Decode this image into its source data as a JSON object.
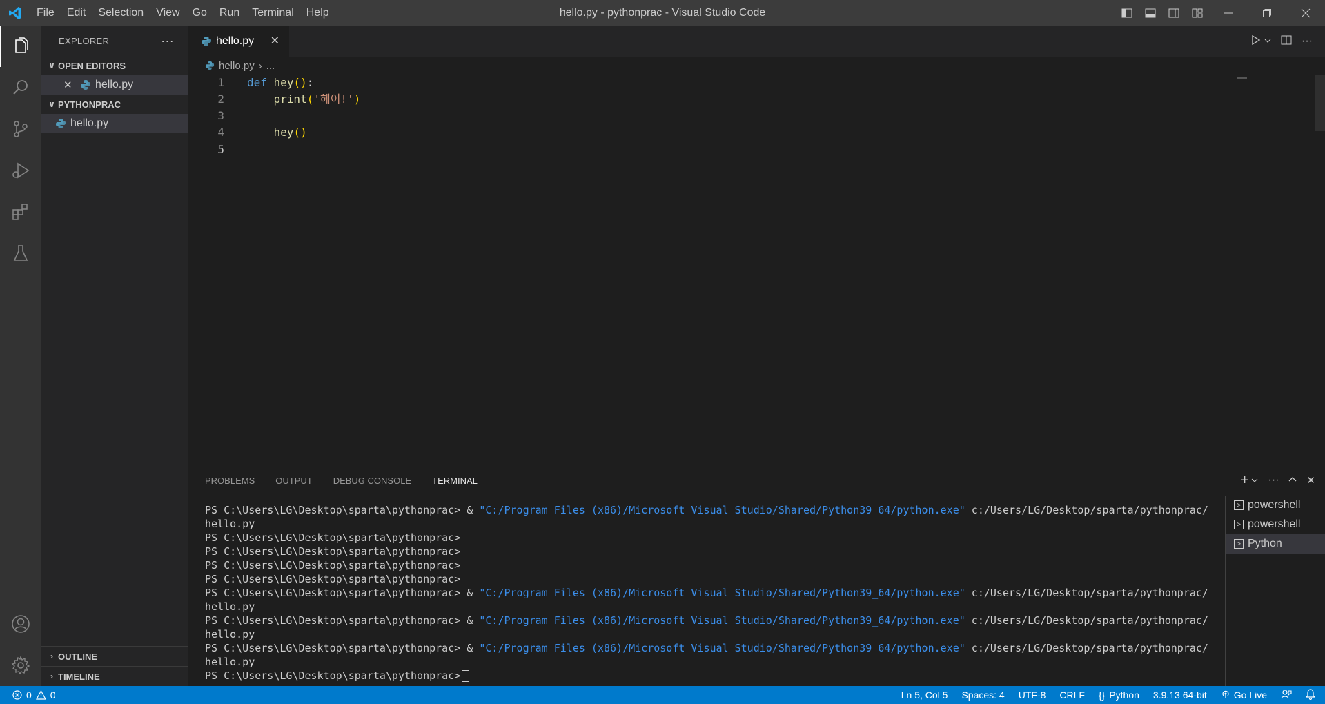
{
  "window": {
    "title": "hello.py - pythonprac - Visual Studio Code",
    "menu": [
      "File",
      "Edit",
      "Selection",
      "View",
      "Go",
      "Run",
      "Terminal",
      "Help"
    ]
  },
  "sidebar": {
    "title": "EXPLORER",
    "open_editors_label": "OPEN EDITORS",
    "open_editors": [
      {
        "name": "hello.py"
      }
    ],
    "project_label": "PYTHONPRAC",
    "files": [
      {
        "name": "hello.py"
      }
    ],
    "outline_label": "OUTLINE",
    "timeline_label": "TIMELINE"
  },
  "editor": {
    "tab": {
      "label": "hello.py"
    },
    "breadcrumb": {
      "file": "hello.py",
      "rest": "..."
    },
    "line_numbers": [
      "1",
      "2",
      "3",
      "4",
      "5"
    ],
    "code": {
      "l1_def": "def",
      "l1_name": "hey",
      "l1_parens": "()",
      "l1_colon": ":",
      "l2_indent": "    ",
      "l2_fn": "print",
      "l2_open": "(",
      "l2_str": "'헤이!'",
      "l2_close": ")",
      "l4_indent": "    ",
      "l4_fn": "hey",
      "l4_parens": "()"
    }
  },
  "panel": {
    "tabs": [
      "PROBLEMS",
      "OUTPUT",
      "DEBUG CONSOLE",
      "TERMINAL"
    ],
    "active_tab": "TERMINAL",
    "terminal": {
      "prompt": "PS C:\\Users\\LG\\Desktop\\sparta\\pythonprac>",
      "amp": " & ",
      "exe_path": "\"C:/Program Files (x86)/Microsoft Visual Studio/Shared/Python39_64/python.exe\"",
      "script_path": " c:/Users/LG/Desktop/sparta/pythonprac/",
      "script_file": "hello.py"
    },
    "terminal_list": [
      "powershell",
      "powershell",
      "Python"
    ]
  },
  "status_bar": {
    "errors": "0",
    "warnings": "0",
    "position": "Ln 5, Col 5",
    "spaces": "Spaces: 4",
    "encoding": "UTF-8",
    "eol": "CRLF",
    "language": "Python",
    "interpreter": "3.9.13 64-bit",
    "go_live": "Go Live"
  },
  "colors": {
    "accent": "#007acc",
    "keyword": "#569cd6",
    "function": "#dcdcaa",
    "string": "#ce9178",
    "bracket": "#ffd700"
  }
}
